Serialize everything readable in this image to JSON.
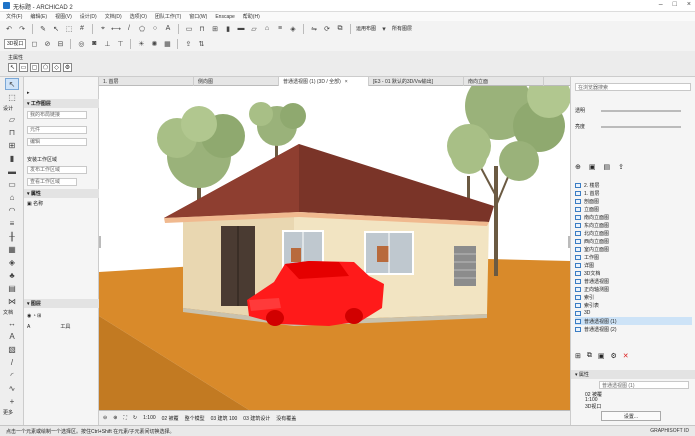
{
  "titlebar": {
    "title": "无标题 - ARCHICAD 2"
  },
  "menu": [
    "文件(F)",
    "编辑(E)",
    "视图(V)",
    "设计(D)",
    "文档(D)",
    "选项(O)",
    "团队工作(T)",
    "窗口(W)",
    "Enscape",
    "帮助(H)"
  ],
  "toolbar": {
    "top_right_labels": [
      "运用布图",
      "所有图层"
    ],
    "layer_select": "3D视口"
  },
  "infobox": {
    "label": "主属性"
  },
  "toolbox": {
    "section_labels": [
      "设计",
      "文档",
      "更多"
    ],
    "bottom_labels": [
      "遍历器",
      "轴头器",
      "电话",
      "文档"
    ]
  },
  "leftpanel": {
    "header1": "工作图层",
    "field_layer": "我的布局链接",
    "field_a": "元件",
    "field_b": "编辑",
    "checkbox": "拖动",
    "sub_header": "安装工作区域",
    "sub_field": "发布工作区域",
    "footer_field": "查看工作区域",
    "section2": "属性",
    "prop_item": "名称",
    "section3": "图层",
    "bottom_select": "A",
    "bottom_select2": "工具"
  },
  "tabs": [
    {
      "label": "1. 首层"
    },
    {
      "label": "侧向图"
    },
    {
      "label": "普通透视图 (1) (3D / 全部)"
    },
    {
      "label": "[E3 - 01 默认的3D/Vw输出]"
    },
    {
      "label": "南向立面"
    }
  ],
  "viewbar": {
    "zoom": "1:100",
    "layer": "02 被覆",
    "model": "整个模型",
    "scale": "03 建筑 100",
    "pen": "03 建筑设计",
    "override": "没有覆盖"
  },
  "rightpanel": {
    "search": "在浏览器搜索",
    "opacity_label": "透明",
    "brightness_label": "亮度",
    "tree": [
      "2. 楼层",
      "1. 首层",
      "剖面图",
      "立面图",
      "南向立面图",
      "东向立面图",
      "北向立面图",
      "西向立面图",
      "室内立面图",
      "工作图",
      "详图",
      "3D文档",
      "普通透视图",
      "正向轴测图",
      "索引",
      "索引表",
      "3D",
      "普通透视图 (1)",
      "普通透视图 (2)"
    ],
    "selected_index": 17,
    "props_header": "属性",
    "props_name": "普通透视图 (1)",
    "props_floor": "02 被覆",
    "props_scale": "1:100",
    "props_view": "3D视口",
    "settings_button": "设置..."
  },
  "statusbar": {
    "hint": "点击一个元素或绘制一个选择区。按住Ctrl+Shift 在元素/子元素间切换选择。",
    "right": "GRAPHISOFT ID"
  },
  "colors": {
    "roof": "#8a3a2d",
    "wall": "#e9d7b1",
    "ground": "#d98a2a",
    "car": "#ff1a1a",
    "sky": "#ffffff"
  }
}
